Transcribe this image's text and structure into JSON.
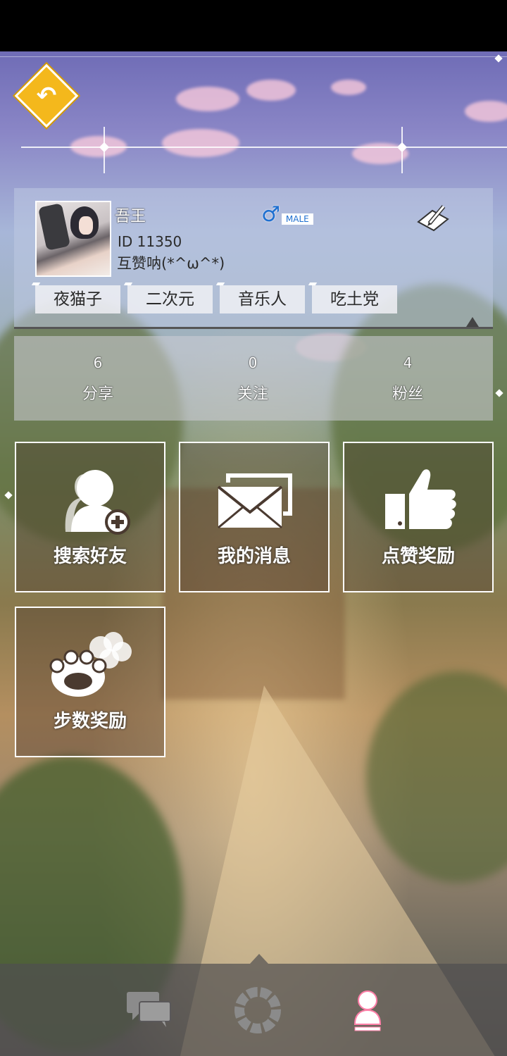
{
  "header": {
    "back_icon": "back-arrow-icon",
    "back_color": "#f4b81c"
  },
  "profile": {
    "nickname": "吾王",
    "id_text": "ID 11350",
    "signature": "互赞呐(*^ω^*)",
    "gender_symbol": "♂",
    "gender_label": "MALE",
    "gender_color": "#1e6fd0",
    "edit_icon": "edit-pencil-icon",
    "tags": [
      "夜猫子",
      "二次元",
      "音乐人",
      "吃土党"
    ]
  },
  "stats": [
    {
      "value": "6",
      "label": "分享"
    },
    {
      "value": "0",
      "label": "关注"
    },
    {
      "value": "4",
      "label": "粉丝"
    }
  ],
  "menu": [
    {
      "label": "搜索好友",
      "icon": "add-friend-icon"
    },
    {
      "label": "我的消息",
      "icon": "mail-icon"
    },
    {
      "label": "点赞奖励",
      "icon": "thumbs-up-icon"
    },
    {
      "label": "步数奖励",
      "icon": "paw-icon"
    }
  ],
  "bottom_nav": [
    {
      "icon": "chat-icon",
      "active": false
    },
    {
      "icon": "loading-wheel-icon",
      "active": false
    },
    {
      "icon": "user-icon",
      "active": true
    }
  ],
  "active_color": "#ff7fa8"
}
